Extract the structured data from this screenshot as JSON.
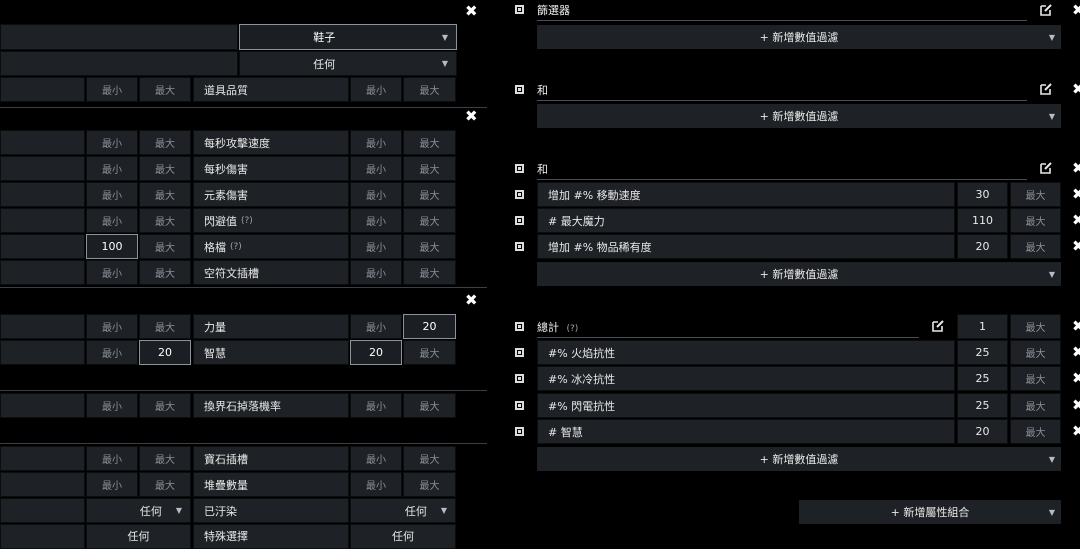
{
  "left": {
    "top_dropdowns": [
      {
        "value": "鞋子"
      },
      {
        "value": "任何"
      }
    ],
    "min_label": "最小",
    "max_label": "最大",
    "any_label": "任何",
    "rows": {
      "item_quality": "道具品質",
      "aps": "每秒攻擊速度",
      "dps": "每秒傷害",
      "elemental_damage": "元素傷害",
      "evasion": "閃避值",
      "block": "格檔",
      "rune_sockets": "空符文插槽",
      "strength": "力量",
      "intelligence": "智慧",
      "chaos_orb_rate": "換界石掉落機率",
      "gem_sockets": "寶石插槽",
      "stack_size": "堆疊數量",
      "corrupted": "已汙染",
      "special_options": "特殊選擇"
    },
    "values": {
      "block_left_min": "100",
      "strength_max": "20",
      "intelligence_left_max": "20",
      "intelligence_min": "20"
    },
    "help_mark": "(?)"
  },
  "right": {
    "groups": [
      {
        "title": "篩選器",
        "add_label": "+ 新增數值過濾"
      },
      {
        "title": "和",
        "add_label": "+ 新增數值過濾"
      },
      {
        "title": "和",
        "add_label": "+ 新增數值過濾",
        "stats": [
          {
            "name": "增加 #% 移動速度",
            "min": "30",
            "max": "最大"
          },
          {
            "name": "# 最大魔力",
            "min": "110",
            "max": "最大"
          },
          {
            "name": "增加 #% 物品稀有度",
            "min": "20",
            "max": "最大"
          }
        ]
      },
      {
        "title": "總計",
        "help": "(?)",
        "count_min": "1",
        "count_max": "最大",
        "add_label": "+ 新增數值過濾",
        "stats": [
          {
            "name": "#% 火焰抗性",
            "min": "25",
            "max": "最大"
          },
          {
            "name": "#% 冰冷抗性",
            "min": "25",
            "max": "最大"
          },
          {
            "name": "#% 閃電抗性",
            "min": "25",
            "max": "最大"
          },
          {
            "name": "# 智慧",
            "min": "20",
            "max": "最大"
          }
        ]
      }
    ],
    "add_group_label": "+ 新增屬性組合"
  },
  "icons": {
    "close": "close-icon",
    "edit": "edit-icon",
    "checkbox": "checkbox-icon",
    "dropdown": "chevron-down-icon"
  }
}
